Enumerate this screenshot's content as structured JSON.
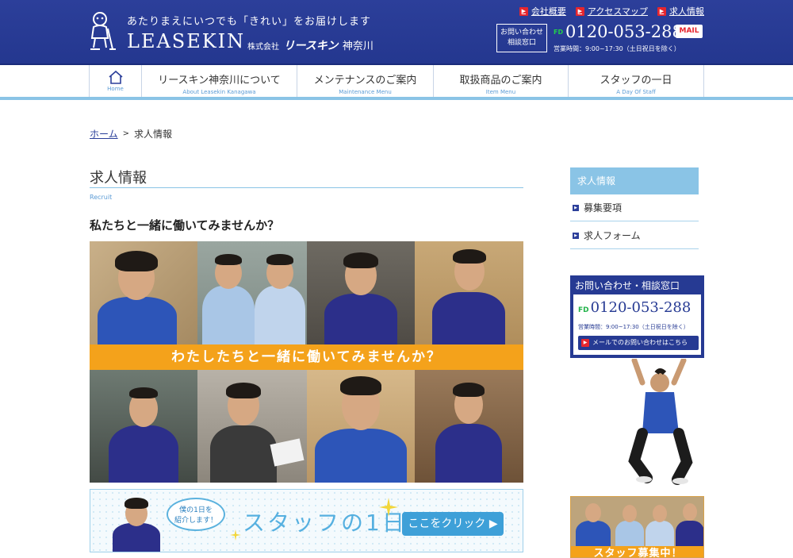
{
  "header": {
    "tagline": "あたりまえにいつでも「きれい」をお届けします",
    "brand": "LEASEKIN",
    "company_prefix": "株式会社",
    "company_logotype": "リースキン",
    "company_region": "神奈川",
    "top_links": [
      {
        "label": "会社概要"
      },
      {
        "label": "アクセスマップ"
      },
      {
        "label": "求人情報"
      }
    ],
    "contact_box": [
      "お問い合わせ",
      "相談窓口"
    ],
    "freedial_mark": "FD",
    "phone": "0120-053-288",
    "mail_label": "MAIL",
    "hours": "営業時間：9:00~17:30（土日祝日を除く）"
  },
  "nav": {
    "home_label": "Home",
    "items": [
      {
        "jp": "リースキン神奈川について",
        "en": "About Leasekin Kanagawa"
      },
      {
        "jp": "メンテナンスのご案内",
        "en": "Maintenance Menu"
      },
      {
        "jp": "取扱商品のご案内",
        "en": "Item Menu"
      },
      {
        "jp": "スタッフの一日",
        "en": "A Day Of Staff"
      }
    ]
  },
  "breadcrumb": {
    "home": "ホーム",
    "separator": ">",
    "current": "求人情報"
  },
  "main": {
    "title": "求人情報",
    "subtitle": "Recruit",
    "section_heading": "私たちと一緒に働いてみませんか？",
    "hero_banner": "わたしたちと一緒に働いてみませんか？",
    "staff_banner": {
      "bubble_line1": "僕の1日を",
      "bubble_line2": "紹介します！",
      "title": "スタッフの1日",
      "button": "ここをクリック ▶"
    }
  },
  "sidebar": {
    "heading": "求人情報",
    "items": [
      {
        "label": "募集要項"
      },
      {
        "label": "求人フォーム"
      }
    ],
    "contact": {
      "title": "お問い合わせ・相談窓口",
      "freedial_mark": "FD",
      "phone": "0120-053-288",
      "hours": "営業時間：9:00~17:30（土日祝日を除く）",
      "mail": "メールでのお問い合わせはこちら"
    },
    "recruit_banner": "スタッフ募集中！"
  },
  "colors": {
    "header_blue": "#2c3f9a",
    "nav_accent": "#8ac4e6",
    "banner_orange": "#f4a21b",
    "arrow_red": "#e6262e"
  }
}
